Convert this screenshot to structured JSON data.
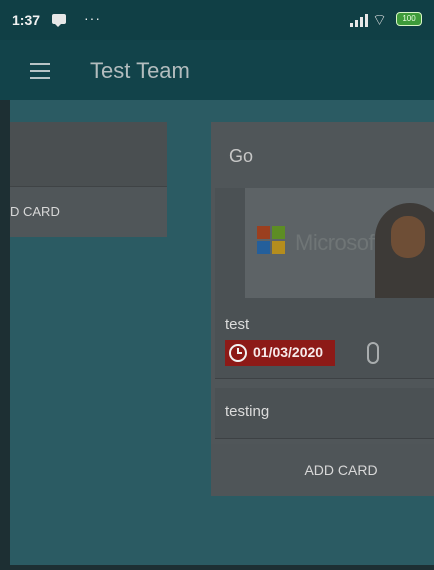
{
  "status_bar": {
    "time": "1:37",
    "dots": "···",
    "battery": "100"
  },
  "app_bar": {
    "title": "Test Team"
  },
  "board": {
    "left_column": {
      "add_card_label": "D CARD"
    },
    "right_column": {
      "title": "Go",
      "cards": [
        {
          "title": "test",
          "due_date": "01/03/2020",
          "image_text": "Microsoft"
        },
        {
          "title": "testing"
        }
      ],
      "add_card_label": "ADD CARD"
    }
  },
  "colors": {
    "app_bar": "#12434a",
    "board_background": "#2b5b63",
    "due_badge": "#8d1a17"
  }
}
